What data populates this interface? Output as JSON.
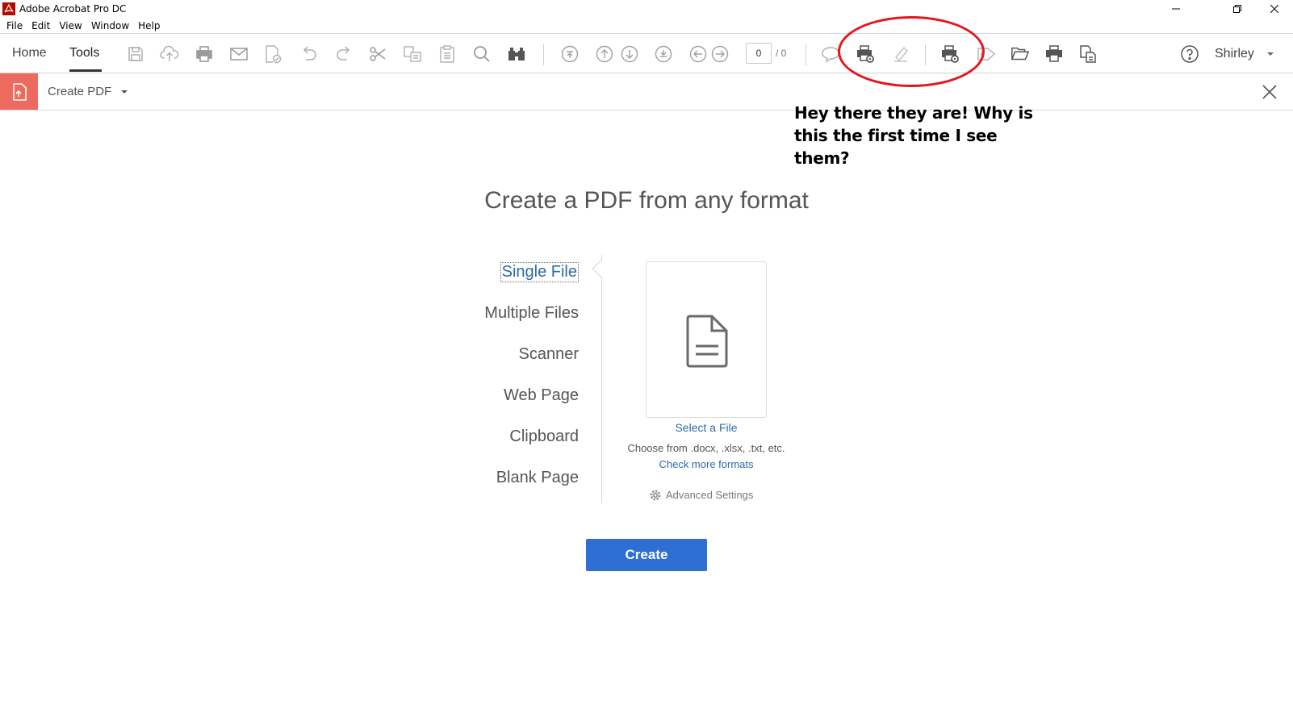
{
  "window": {
    "title": "Adobe Acrobat Pro DC"
  },
  "menu": [
    "File",
    "Edit",
    "View",
    "Window",
    "Help"
  ],
  "toolbar": {
    "tabs": [
      "Home",
      "Tools"
    ],
    "active_tab": "Tools",
    "page_value": "0",
    "page_total": "/ 0",
    "user": "Shirley",
    "icons": [
      "save-icon",
      "upload-cloud-icon",
      "print-icon",
      "email-icon",
      "sign-icon",
      "undo-icon",
      "redo-icon",
      "cut-icon",
      "copy-icon",
      "paste-icon",
      "search-icon",
      "binoculars-icon",
      "first-page-icon",
      "prev-page-icon",
      "next-page-icon",
      "last-page-icon",
      "back-icon",
      "forward-icon",
      "comment-icon",
      "print-settings-icon",
      "highlight-icon",
      "print-settings-2-icon",
      "tag-icon",
      "open-folder-icon",
      "print-2-icon",
      "convert-icon",
      "help-icon"
    ]
  },
  "tool_header": {
    "name": "Create PDF"
  },
  "annotation": {
    "text": "Hey there they are!  Why is this the first time I see them?",
    "color": "#e8141b"
  },
  "main": {
    "headline": "Create a PDF from any format",
    "options": [
      "Single File",
      "Multiple Files",
      "Scanner",
      "Web Page",
      "Clipboard",
      "Blank Page"
    ],
    "selected_option": "Single File",
    "select_file": "Select a File",
    "choose_from": "Choose from .docx, .xlsx, .txt, etc.",
    "check_formats": "Check more formats",
    "advanced_settings": "Advanced Settings",
    "create_button": "Create"
  },
  "colors": {
    "accent": "#2d6fd2",
    "link": "#2d6aa8",
    "tool_badge": "#ed6a5e",
    "annotation": "#e8141b"
  }
}
